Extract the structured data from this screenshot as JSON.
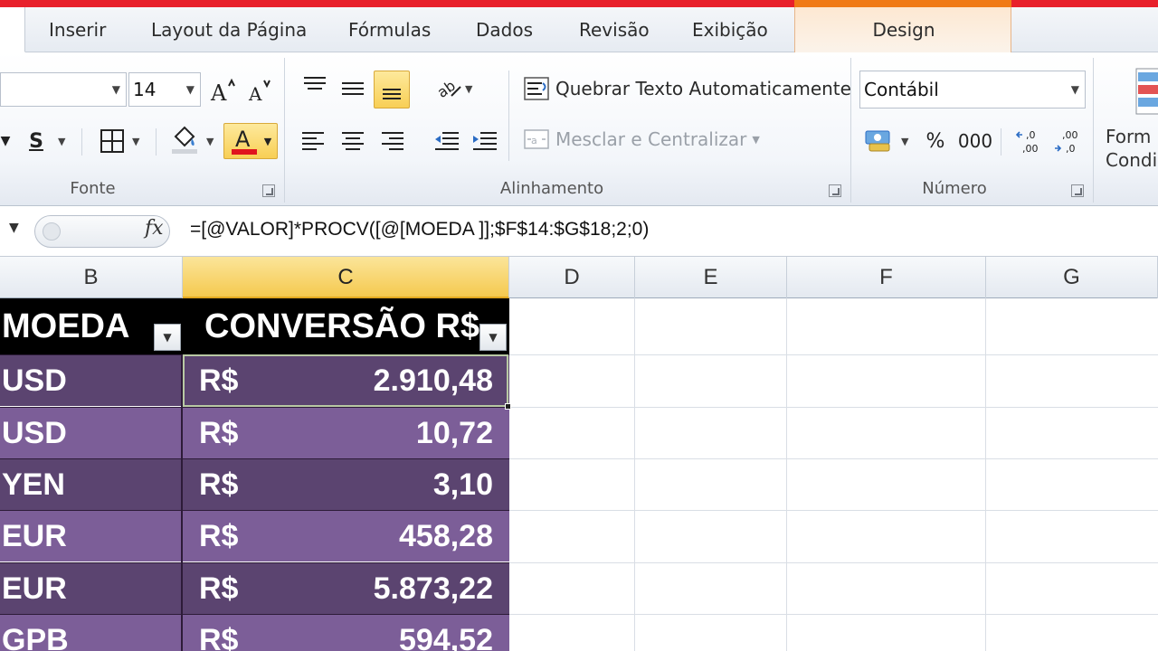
{
  "tabs": [
    "Inserir",
    "Layout da Página",
    "Fórmulas",
    "Dados",
    "Revisão",
    "Exibição"
  ],
  "context_tab": "Design",
  "ribbon": {
    "font": {
      "label": "Fonte",
      "size": "14"
    },
    "alignment": {
      "label": "Alinhamento",
      "wrap_text": "Quebrar Texto Automaticamente",
      "merge_center": "Mesclar e Centralizar"
    },
    "number": {
      "label": "Número",
      "format": "Contábil",
      "percent": "%",
      "thousands": "000"
    },
    "styles": {
      "conditional_line1": "Form",
      "conditional_line2": "Condi"
    }
  },
  "formula_bar": {
    "fx": "fx",
    "formula": "=[@VALOR]*PROCV([@[MOEDA ]];$F$14:$G$18;2;0)"
  },
  "columns": [
    "B",
    "C",
    "D",
    "E",
    "F",
    "G"
  ],
  "table": {
    "headers": [
      "MOEDA",
      "CONVERSÃO R$"
    ],
    "currency_symbol": "R$",
    "rows": [
      {
        "moeda": "USD",
        "valor": "2.910,48"
      },
      {
        "moeda": "USD",
        "valor": "10,72"
      },
      {
        "moeda": "YEN",
        "valor": "3,10"
      },
      {
        "moeda": "EUR",
        "valor": "458,28"
      },
      {
        "moeda": "EUR",
        "valor": "5.873,22"
      },
      {
        "moeda": "GPB",
        "valor": "594,52"
      }
    ]
  },
  "colors": {
    "row_dark": "#5b4470",
    "row_light": "#7c5e98",
    "header_bg": "#000000",
    "highlight": "#f8cf55",
    "font_color_bar": "#e0141e"
  }
}
